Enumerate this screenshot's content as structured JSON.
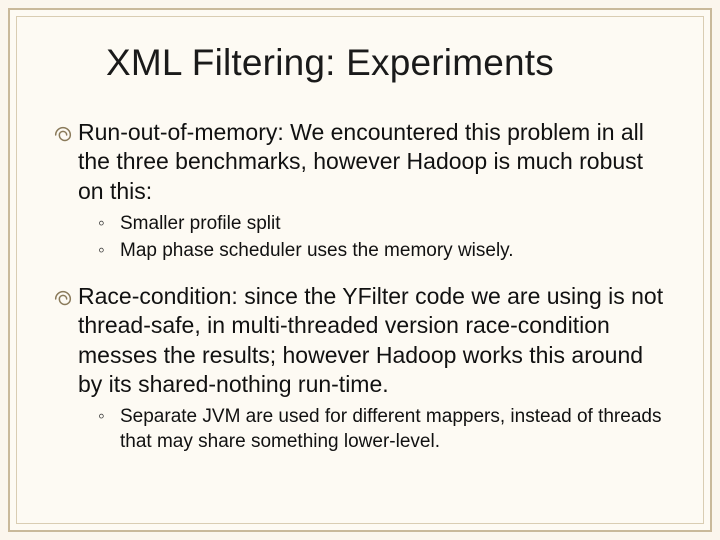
{
  "title": "XML Filtering: Experiments",
  "bullets": [
    {
      "text": "Run-out-of-memory: We encountered this problem in all the three benchmarks, however Hadoop is much robust on this:",
      "subs": [
        "Smaller profile split",
        "Map phase scheduler uses the memory wisely."
      ]
    },
    {
      "text": "Race-condition: since the YFilter code we are using is not thread-safe, in multi-threaded version race-condition messes the results; however Hadoop works this around by its shared-nothing run-time.",
      "subs": [
        "Separate JVM are used for different mappers, instead of threads that may share something lower-level."
      ]
    }
  ]
}
